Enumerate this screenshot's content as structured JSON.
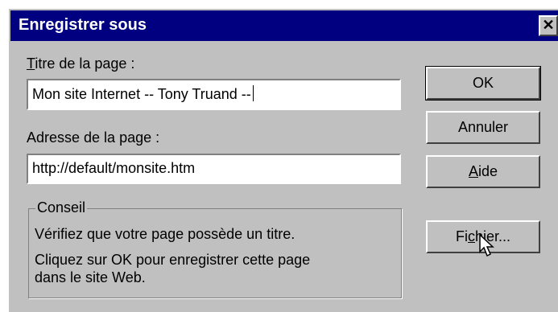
{
  "window": {
    "title": "Enregistrer sous",
    "close_symbol": "✕"
  },
  "form": {
    "page_title_label_mnemonic": "T",
    "page_title_label_rest": "itre de la page :",
    "page_title_value": "Mon site Internet -- Tony Truand --",
    "page_address_label": "Adresse de la page :",
    "page_address_value": "http://default/monsite.htm"
  },
  "tip": {
    "legend": "Conseil",
    "line1": "Vérifiez que votre page possède un titre.",
    "line2": "Cliquez sur OK pour enregistrer cette page",
    "line3": "dans le site Web."
  },
  "buttons": {
    "ok": "OK",
    "cancel": "Annuler",
    "help_mnemonic": "A",
    "help_rest": "ide",
    "file_prefix": "Fi",
    "file_mnemonic": "c",
    "file_rest": "hier..."
  },
  "icons": {
    "close": "close-icon",
    "cursor": "mouse-pointer-icon"
  }
}
